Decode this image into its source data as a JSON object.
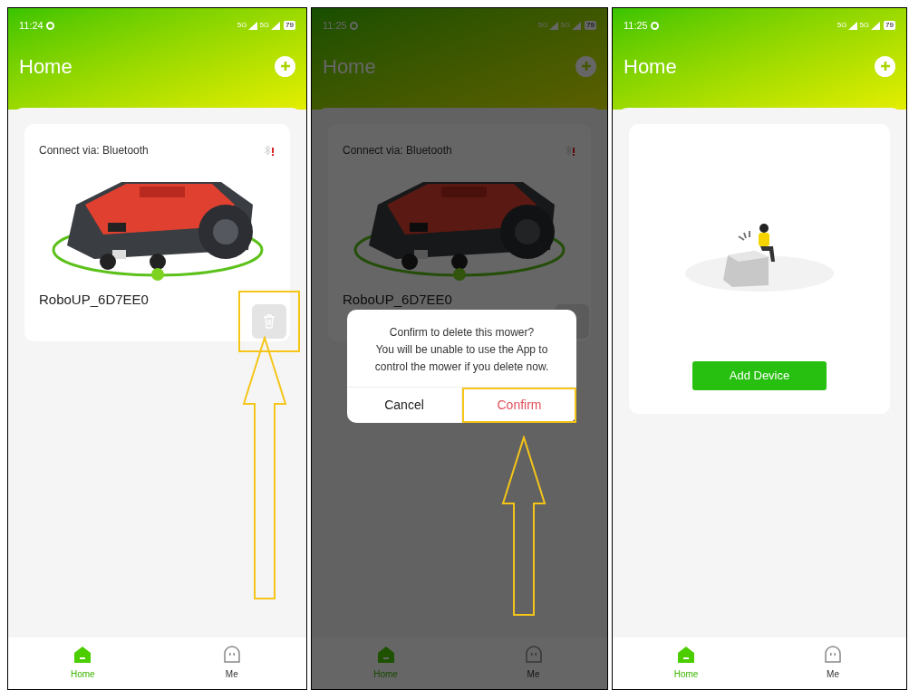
{
  "screens": [
    {
      "kind": "device",
      "status_bar": {
        "time": "11:24",
        "networks": [
          "5G",
          "5G"
        ],
        "battery": "79"
      },
      "title": "Home",
      "device": {
        "connection": "Connect via: Bluetooth",
        "name": "RoboUP_6D7EE0",
        "delete_highlighted": true
      },
      "nav": [
        {
          "label": "Home",
          "selected": true
        },
        {
          "label": "Me",
          "selected": false
        }
      ]
    },
    {
      "kind": "device",
      "status_bar": {
        "time": "11:25",
        "networks": [
          "5G",
          "5G"
        ],
        "battery": "79"
      },
      "title": "Home",
      "device": {
        "connection": "Connect via: Bluetooth",
        "name": "RoboUP_6D7EE0",
        "delete_highlighted": false
      },
      "dialog": {
        "message": "Confirm to delete this mower?\nYou will be unable to use the App to\ncontrol the mower if you delete now.",
        "buttons": [
          {
            "label": "Cancel",
            "kind": "cancel",
            "highlighted": false
          },
          {
            "label": "Confirm",
            "kind": "confirm",
            "highlighted": true
          }
        ]
      },
      "nav": [
        {
          "label": "Home",
          "selected": true
        },
        {
          "label": "Me",
          "selected": false
        }
      ]
    },
    {
      "kind": "empty",
      "status_bar": {
        "time": "11:25",
        "networks": [
          "5G",
          "5G"
        ],
        "battery": "79"
      },
      "title": "Home",
      "empty": {
        "button": "Add Device"
      },
      "nav": [
        {
          "label": "Home",
          "selected": true
        },
        {
          "label": "Me",
          "selected": false
        }
      ]
    }
  ]
}
